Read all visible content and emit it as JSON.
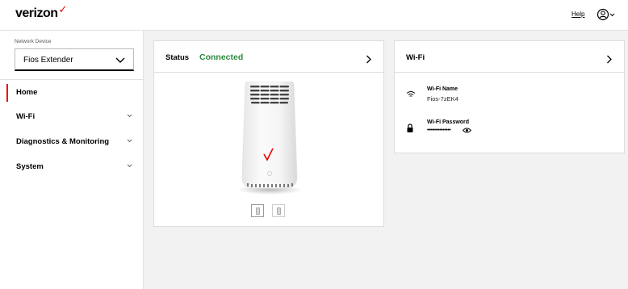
{
  "header": {
    "brand": "verizon",
    "brand_mark": "✓",
    "help_link": "Help",
    "user_icon": "user-icon"
  },
  "sidebar": {
    "network_device_label": "Network Device",
    "device_selected": "Fios Extender",
    "items": [
      {
        "label": "Home",
        "active": true
      },
      {
        "label": "Wi-Fi",
        "expandable": true
      },
      {
        "label": "Diagnostics & Monitoring",
        "expandable": true
      },
      {
        "label": "System",
        "expandable": true
      }
    ]
  },
  "status_card": {
    "title": "Status",
    "status": "Connected",
    "status_color": "#2b8a3e",
    "image_thumbnails": 2
  },
  "wifi_card": {
    "title": "Wi-Fi",
    "name_label": "Wi-Fi Name",
    "name_value": "Fios-7zEK4",
    "password_label": "Wi-Fi Password",
    "password_mask": "•••••••••••••••"
  },
  "colors": {
    "accent": "#e00000",
    "connected": "#2b8a3e",
    "background": "#f2f2f2"
  }
}
